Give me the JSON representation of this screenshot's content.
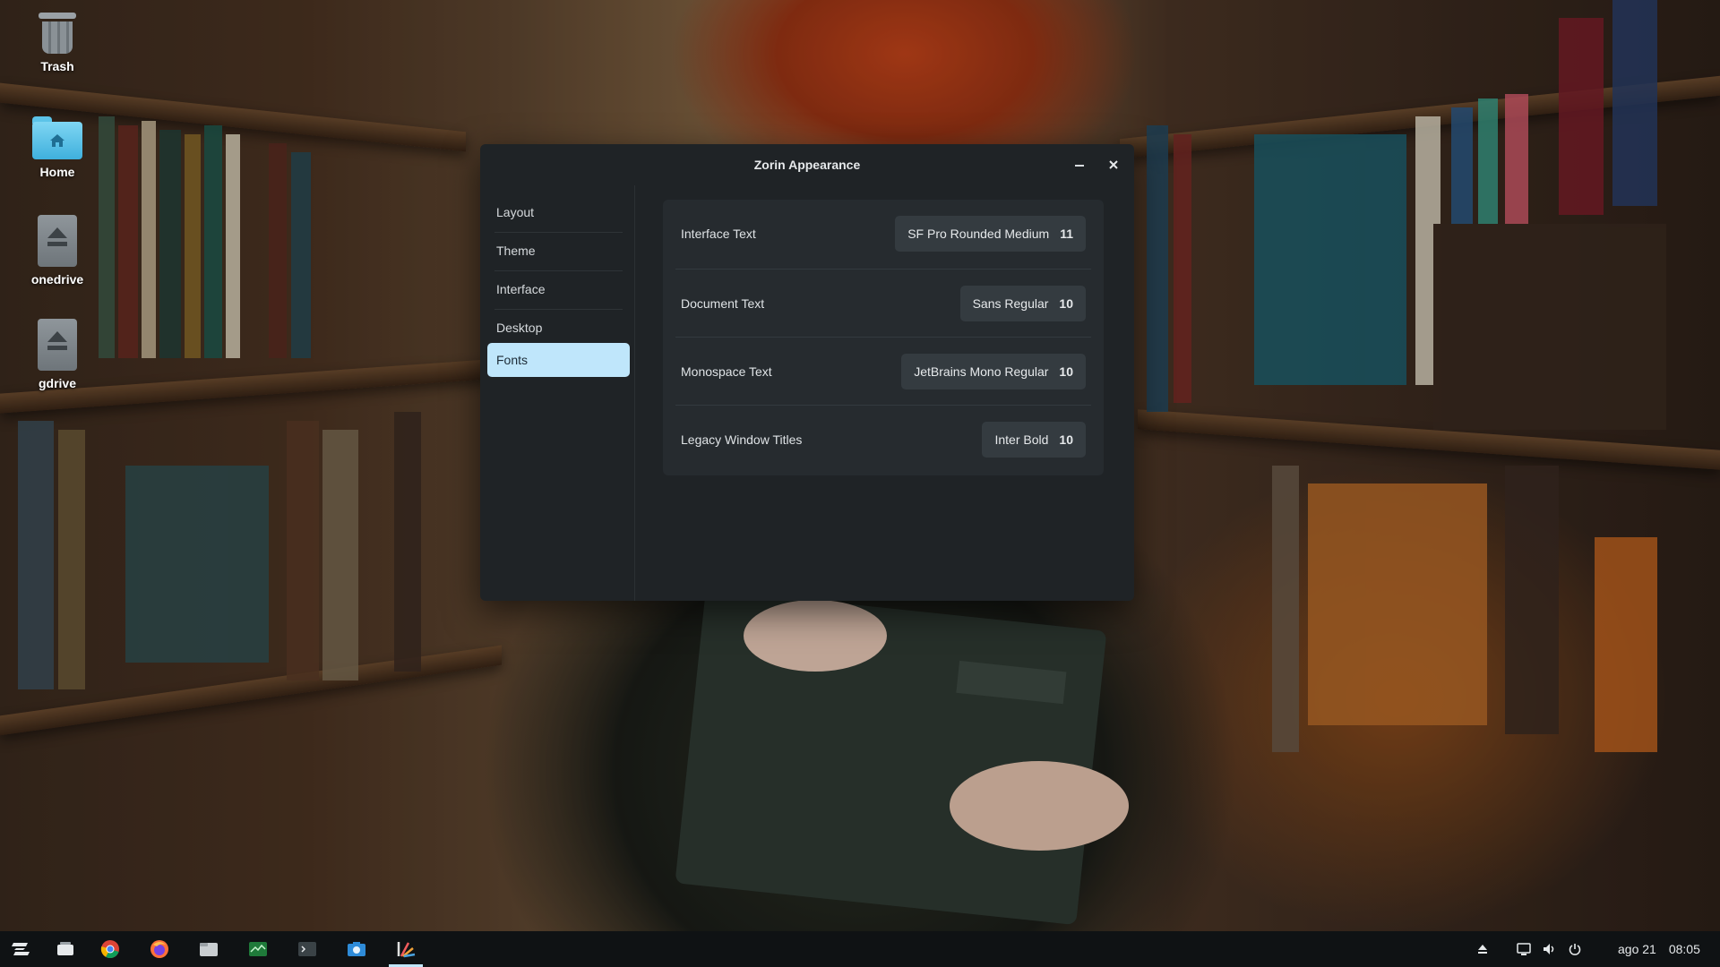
{
  "desktop": {
    "icons": [
      {
        "label": "Trash",
        "icon": "trash-icon"
      },
      {
        "label": "Home",
        "icon": "home-folder-icon"
      },
      {
        "label": "onedrive",
        "icon": "drive-eject-icon"
      },
      {
        "label": "gdrive",
        "icon": "drive-eject-icon"
      }
    ]
  },
  "window": {
    "title": "Zorin Appearance",
    "minimize_icon": "minimize-icon",
    "close_icon": "close-icon"
  },
  "sidebar": {
    "items": [
      {
        "label": "Layout",
        "active": false
      },
      {
        "label": "Theme",
        "active": false
      },
      {
        "label": "Interface",
        "active": false
      },
      {
        "label": "Desktop",
        "active": false
      },
      {
        "label": "Fonts",
        "active": true
      }
    ],
    "accent": "#bfe6fb"
  },
  "fonts": {
    "rows": [
      {
        "label": "Interface Text",
        "font": "SF Pro Rounded Medium",
        "size": "11"
      },
      {
        "label": "Document Text",
        "font": "Sans Regular",
        "size": "10"
      },
      {
        "label": "Monospace Text",
        "font": "JetBrains Mono Regular",
        "size": "10"
      },
      {
        "label": "Legacy Window Titles",
        "font": "Inter Bold",
        "size": "10"
      }
    ]
  },
  "taskbar": {
    "apps": [
      {
        "icon": "zorin-menu-icon"
      },
      {
        "icon": "workspaces-icon"
      },
      {
        "icon": "chrome-icon"
      },
      {
        "icon": "firefox-icon"
      },
      {
        "icon": "files-icon"
      },
      {
        "icon": "system-monitor-icon"
      },
      {
        "icon": "terminal-icon"
      },
      {
        "icon": "screenshot-icon"
      },
      {
        "icon": "zorin-appearance-icon",
        "active": true
      }
    ],
    "tray": {
      "eject_icon": "eject-icon",
      "screen_icon": "screen-icon",
      "volume_icon": "volume-icon",
      "power_icon": "power-icon",
      "date": "ago 21",
      "time": "08:05"
    }
  }
}
